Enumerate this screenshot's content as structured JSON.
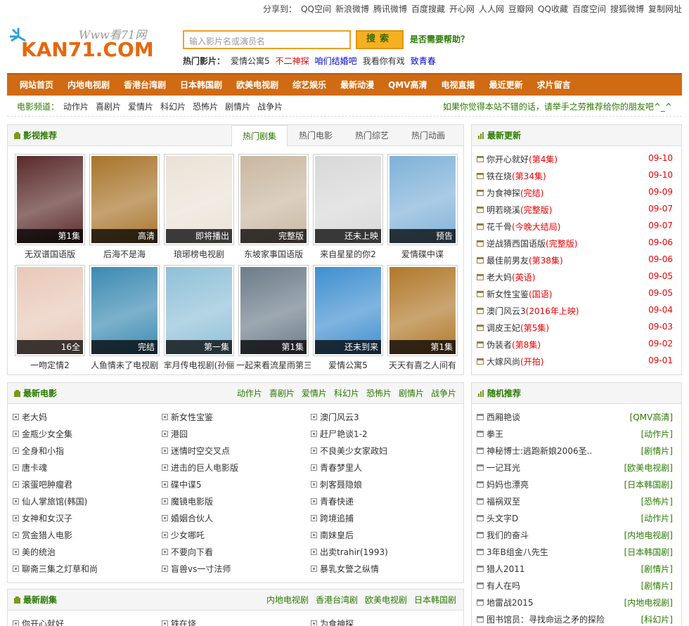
{
  "share": {
    "label": "分享到：",
    "items": [
      "QQ空间",
      "新浪微博",
      "腾讯微博",
      "百度搜藏",
      "开心网",
      "人人网",
      "豆瓣网",
      "QQ收藏",
      "百度空间",
      "搜狐微博",
      "复制网址"
    ]
  },
  "logo": {
    "www": "Www看71网",
    "main": "KAN71.COM"
  },
  "search": {
    "placeholder": "输入影片名或演员名",
    "button": "搜索",
    "help": "是否需要帮助？"
  },
  "hot": {
    "label": "热门影片：",
    "items": [
      {
        "text": "爱情公寓5",
        "color": "#333333"
      },
      {
        "text": "不二神探",
        "color": "#e00000"
      },
      {
        "text": "咱们结婚吧",
        "color": "#0000cc"
      },
      {
        "text": "我看你有戏",
        "color": "#333333"
      },
      {
        "text": "致青春",
        "color": "#0000cc"
      }
    ]
  },
  "nav": [
    "网站首页",
    "内地电视剧",
    "香港台湾剧",
    "日本韩国剧",
    "欧美电视剧",
    "综艺娱乐",
    "最新动漫",
    "QMV高清",
    "电视直播",
    "最近更新",
    "求片留言"
  ],
  "subnav": {
    "label": "电影频道：",
    "items": [
      "动作片",
      "喜剧片",
      "爱情片",
      "科幻片",
      "恐怖片",
      "剧情片",
      "战争片"
    ],
    "slogan": "如果你觉得本站不错的话，请举手之劳推荐给你的朋友吧^_^"
  },
  "recommend": {
    "title": "影视推荐",
    "tabs": [
      "热门剧集",
      "热门电影",
      "热门综艺",
      "热门动画"
    ],
    "posters": [
      {
        "name": "无双谱国语版",
        "badge": "第1集",
        "bg": "#5a2a2a"
      },
      {
        "name": "后海不是海",
        "badge": "高清",
        "bg": "#a8742a"
      },
      {
        "name": "琅琊榜电视剧",
        "badge": "即将播出",
        "bg": "#eae2d6"
      },
      {
        "name": "东坡家事国语版",
        "badge": "完整版",
        "bg": "#c9b7a1"
      },
      {
        "name": "来自星星的你2",
        "badge": "还未上映",
        "bg": "#d8d8d8"
      },
      {
        "name": "爱情碟中谍",
        "badge": "预告",
        "bg": "#7fb1d8"
      },
      {
        "name": "一吻定情2",
        "badge": "16全",
        "bg": "#e8c8b8"
      },
      {
        "name": "人鱼情未了电视剧",
        "badge": "完结",
        "bg": "#3b8ab2"
      },
      {
        "name": "芈月传电视剧(孙俪",
        "badge": "第一集",
        "bg": "#8fc0d8"
      },
      {
        "name": "一起来看流星雨第三",
        "badge": "第1集",
        "bg": "#6c7c8a"
      },
      {
        "name": "爱情公寓5",
        "badge": "还未到来",
        "bg": "#3f8fd0"
      },
      {
        "name": "天天有喜之人间有",
        "badge": "第1集",
        "bg": "#b0782a"
      }
    ]
  },
  "latest_updates": {
    "title": "最新更新",
    "items": [
      {
        "name": "你开心就好",
        "note": "(第4集)",
        "date": "09-10"
      },
      {
        "name": "铁在烧",
        "note": "(第34集)",
        "date": "09-10"
      },
      {
        "name": "为食神探",
        "note": "(完结)",
        "date": "09-09"
      },
      {
        "name": "明若晓溪",
        "note": "(完整版)",
        "date": "09-07"
      },
      {
        "name": "花千骨",
        "note": "(今晚大结局)",
        "date": "09-07"
      },
      {
        "name": "逆战猜西国语版",
        "note": "(完整版)",
        "date": "09-06"
      },
      {
        "name": "最佳前男友",
        "note": "(第38集)",
        "date": "09-06"
      },
      {
        "name": "老大妈",
        "note": "(英语)",
        "date": "09-05"
      },
      {
        "name": "新女性宝鉴",
        "note": "(国语)",
        "date": "09-05"
      },
      {
        "name": "澳门风云3",
        "note": "(2016年上映)",
        "date": "09-04"
      },
      {
        "name": "调皮王妃",
        "note": "(第5集)",
        "date": "09-03"
      },
      {
        "name": "伪装者",
        "note": "(第8集)",
        "date": "09-02"
      },
      {
        "name": "大嫁风尚",
        "note": "(开拍)",
        "date": "09-01"
      }
    ]
  },
  "latest_movies": {
    "title": "最新电影",
    "links": [
      "动作片",
      "喜剧片",
      "爱情片",
      "科幻片",
      "恐怖片",
      "剧情片",
      "战争片"
    ],
    "columns": [
      [
        "老大妈",
        "金瓶少女全集",
        "全身和小指",
        "唐卡魂",
        "滚蛋吧肿瘤君",
        "仙人掌旅馆(韩国)",
        "女神和女汉子",
        "赏金猎人电影",
        "美的统治",
        "聊斋三集之灯草和尚"
      ],
      [
        "新女性宝鉴",
        "港囧",
        "迷情时空交叉点",
        "进击的巨人电影版",
        "碟中谍5",
        "魔镜电影版",
        "婚姻合伙人",
        "少女哪吒",
        "不要向下看",
        "盲兽vs一寸法师"
      ],
      [
        "澳门风云3",
        "赶尸艳谈1-2",
        "不良美少女家政妇",
        "青春梦里人",
        "刺客聂隐娘",
        "青春快递",
        "跨境追捕",
        "南妹皇后",
        "出卖trahir(1993)",
        "暴乳女警之纵情"
      ]
    ]
  },
  "random": {
    "title": "随机推荐",
    "items": [
      {
        "name": "西厢艳谈",
        "tag": "[QMV高清]"
      },
      {
        "name": "拳王",
        "tag": "[动作片]"
      },
      {
        "name": "神秘博士:逃跑新娘2006圣..",
        "tag": "[剧情片]"
      },
      {
        "name": "一记耳光",
        "tag": "[欧美电视剧]"
      },
      {
        "name": "妈妈也漂亮",
        "tag": "[日本韩国剧]"
      },
      {
        "name": "福祸双至",
        "tag": "[恐怖片]"
      },
      {
        "name": "头文字D",
        "tag": "[动作片]"
      },
      {
        "name": "我们的奋斗",
        "tag": "[内地电视剧]"
      },
      {
        "name": "3年B组金八先生",
        "tag": "[日本韩国剧]"
      },
      {
        "name": "猎人2011",
        "tag": "[剧情片]"
      },
      {
        "name": "有人在吗",
        "tag": "[剧情片]"
      },
      {
        "name": "地雷战2015",
        "tag": "[内地电视剧]"
      },
      {
        "name": "图书馆员：寻找命运之矛的探险",
        "tag": "[科幻片]"
      }
    ]
  },
  "latest_series": {
    "title": "最新剧集",
    "links": [
      "内地电视剧",
      "香港台湾剧",
      "欧美电视剧",
      "日本韩国剧"
    ],
    "first_row": [
      "你开心就好",
      "铁在烧",
      "为食神探"
    ]
  }
}
